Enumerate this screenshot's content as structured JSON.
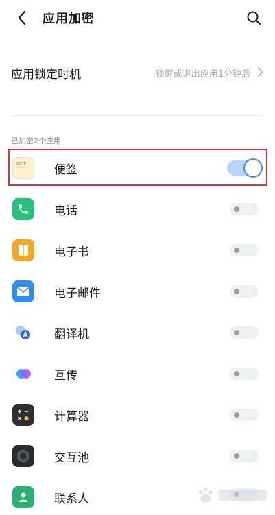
{
  "header": {
    "title": "应用加密",
    "back_icon": "chevron-left-icon",
    "search_icon": "search-icon"
  },
  "lock_timing": {
    "label": "应用锁定时机",
    "value": "锁屏或退出应用1分钟后"
  },
  "section": {
    "label": "已加密2个应用"
  },
  "apps": [
    {
      "name": "便签",
      "icon": "notes-icon",
      "enabled": true
    },
    {
      "name": "电话",
      "icon": "phone-icon",
      "enabled": false
    },
    {
      "name": "电子书",
      "icon": "ebook-icon",
      "enabled": false
    },
    {
      "name": "电子邮件",
      "icon": "email-icon",
      "enabled": false
    },
    {
      "name": "翻译机",
      "icon": "translator-icon",
      "enabled": false
    },
    {
      "name": "互传",
      "icon": "share-icon",
      "enabled": false
    },
    {
      "name": "计算器",
      "icon": "calculator-icon",
      "enabled": false
    },
    {
      "name": "交互池",
      "icon": "interaction-pool-icon",
      "enabled": false
    },
    {
      "name": "联系人",
      "icon": "contacts-icon",
      "enabled": false
    }
  ],
  "notes_icon_text": "NOTE",
  "colors": {
    "highlight_border": "#d23b3b",
    "toggle_on": "#3f8ee8",
    "toggle_on_track": "#b9d5f7",
    "phone_green": "#27c17a",
    "ebook_orange": "#f5a623",
    "email_blue": "#2e8ef1",
    "contacts_green": "#2ab06f"
  }
}
